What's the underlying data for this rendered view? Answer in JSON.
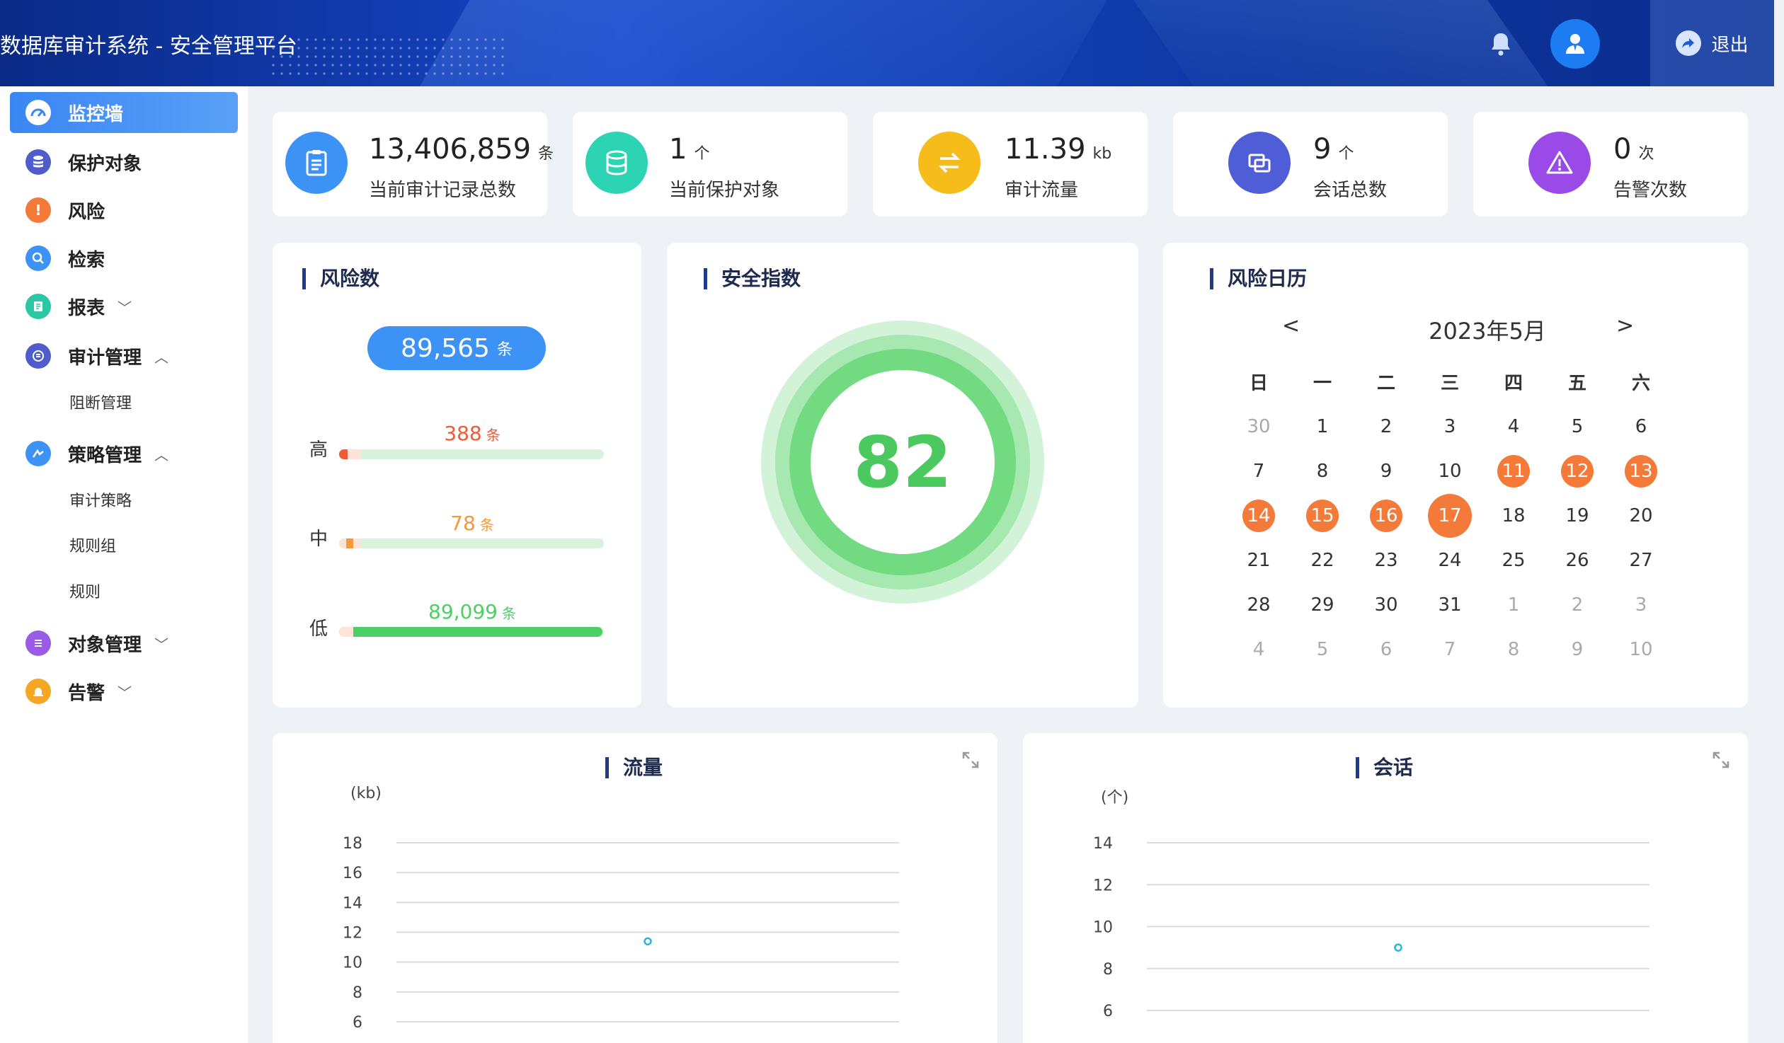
{
  "header": {
    "title": "数据库审计系统 - 安全管理平台",
    "logout_label": "退出"
  },
  "sidebar": {
    "items": [
      {
        "label": "监控墙",
        "color": "#ffffff"
      },
      {
        "label": "保护对象",
        "color": "#4f5dcc"
      },
      {
        "label": "风险",
        "color": "#f47a3a"
      },
      {
        "label": "检索",
        "color": "#3d93f5"
      },
      {
        "label": "报表",
        "color": "#2bc6a4"
      },
      {
        "label": "审计管理",
        "color": "#4f5dcc"
      },
      {
        "label": "策略管理",
        "color": "#3d93f5"
      },
      {
        "label": "对象管理",
        "color": "#9a5ce6"
      },
      {
        "label": "告警",
        "color": "#f5a623"
      }
    ],
    "audit_sub": [
      "阻断管理"
    ],
    "policy_sub": [
      "审计策略",
      "规则组",
      "规则"
    ]
  },
  "stats": [
    {
      "value": "13,406,859",
      "unit": "条",
      "label": "当前审计记录总数",
      "color": "#3d93f5"
    },
    {
      "value": "1",
      "unit": "个",
      "label": "当前保护对象",
      "color": "#2dd4b4"
    },
    {
      "value": "11.39",
      "unit": "kb",
      "label": "审计流量",
      "color": "#f5bc1a"
    },
    {
      "value": "9",
      "unit": "个",
      "label": "会话总数",
      "color": "#4f5dd6"
    },
    {
      "value": "0",
      "unit": "次",
      "label": "告警次数",
      "color": "#9a4ae6"
    }
  ],
  "risk": {
    "title": "风险数",
    "total": "89,565",
    "unit": "条",
    "levels": [
      {
        "label": "高",
        "count": "388",
        "fraction": 0.004,
        "color": "#f05a3a"
      },
      {
        "label": "中",
        "count": "78",
        "fraction": 0.001,
        "color": "#f59a3a"
      },
      {
        "label": "低",
        "count": "89,099",
        "fraction": 0.995,
        "color": "#4cd065"
      }
    ]
  },
  "security": {
    "title": "安全指数",
    "score": "82"
  },
  "calendar": {
    "title": "风险日历",
    "month": "2023年5月",
    "prev": "<",
    "next": ">",
    "weekdays": [
      "日",
      "一",
      "二",
      "三",
      "四",
      "五",
      "六"
    ],
    "weeks": [
      [
        [
          "30",
          "dim"
        ],
        [
          "1",
          ""
        ],
        [
          "2",
          ""
        ],
        [
          "3",
          ""
        ],
        [
          "4",
          ""
        ],
        [
          "5",
          ""
        ],
        [
          "6",
          ""
        ]
      ],
      [
        [
          "7",
          ""
        ],
        [
          "8",
          ""
        ],
        [
          "9",
          ""
        ],
        [
          "10",
          ""
        ],
        [
          "11",
          "risk"
        ],
        [
          "12",
          "risk"
        ],
        [
          "13",
          "risk"
        ]
      ],
      [
        [
          "14",
          "risk"
        ],
        [
          "15",
          "risk"
        ],
        [
          "16",
          "risk"
        ],
        [
          "17",
          "today"
        ],
        [
          "18",
          ""
        ],
        [
          "19",
          ""
        ],
        [
          "20",
          ""
        ]
      ],
      [
        [
          "21",
          ""
        ],
        [
          "22",
          ""
        ],
        [
          "23",
          ""
        ],
        [
          "24",
          ""
        ],
        [
          "25",
          ""
        ],
        [
          "26",
          ""
        ],
        [
          "27",
          ""
        ]
      ],
      [
        [
          "28",
          ""
        ],
        [
          "29",
          ""
        ],
        [
          "30",
          ""
        ],
        [
          "31",
          ""
        ],
        [
          "1",
          "dim"
        ],
        [
          "2",
          "dim"
        ],
        [
          "3",
          "dim"
        ]
      ],
      [
        [
          "4",
          "dim"
        ],
        [
          "5",
          "dim"
        ],
        [
          "6",
          "dim"
        ],
        [
          "7",
          "dim"
        ],
        [
          "8",
          "dim"
        ],
        [
          "9",
          "dim"
        ],
        [
          "10",
          "dim"
        ]
      ]
    ]
  },
  "chart_data": [
    {
      "type": "line",
      "title": "流量",
      "ylabel": "(kb)",
      "yticks": [
        6,
        8,
        10,
        12,
        14,
        16,
        18
      ],
      "ylim": [
        6,
        18
      ],
      "series": [
        {
          "values": [
            11.39
          ]
        }
      ],
      "color": "#2ab7d8"
    },
    {
      "type": "line",
      "title": "会话",
      "ylabel": "(个)",
      "yticks": [
        6,
        8,
        10,
        12,
        14
      ],
      "ylim": [
        6,
        14
      ],
      "series": [
        {
          "values": [
            9
          ]
        }
      ],
      "color": "#2ab7d8"
    }
  ]
}
